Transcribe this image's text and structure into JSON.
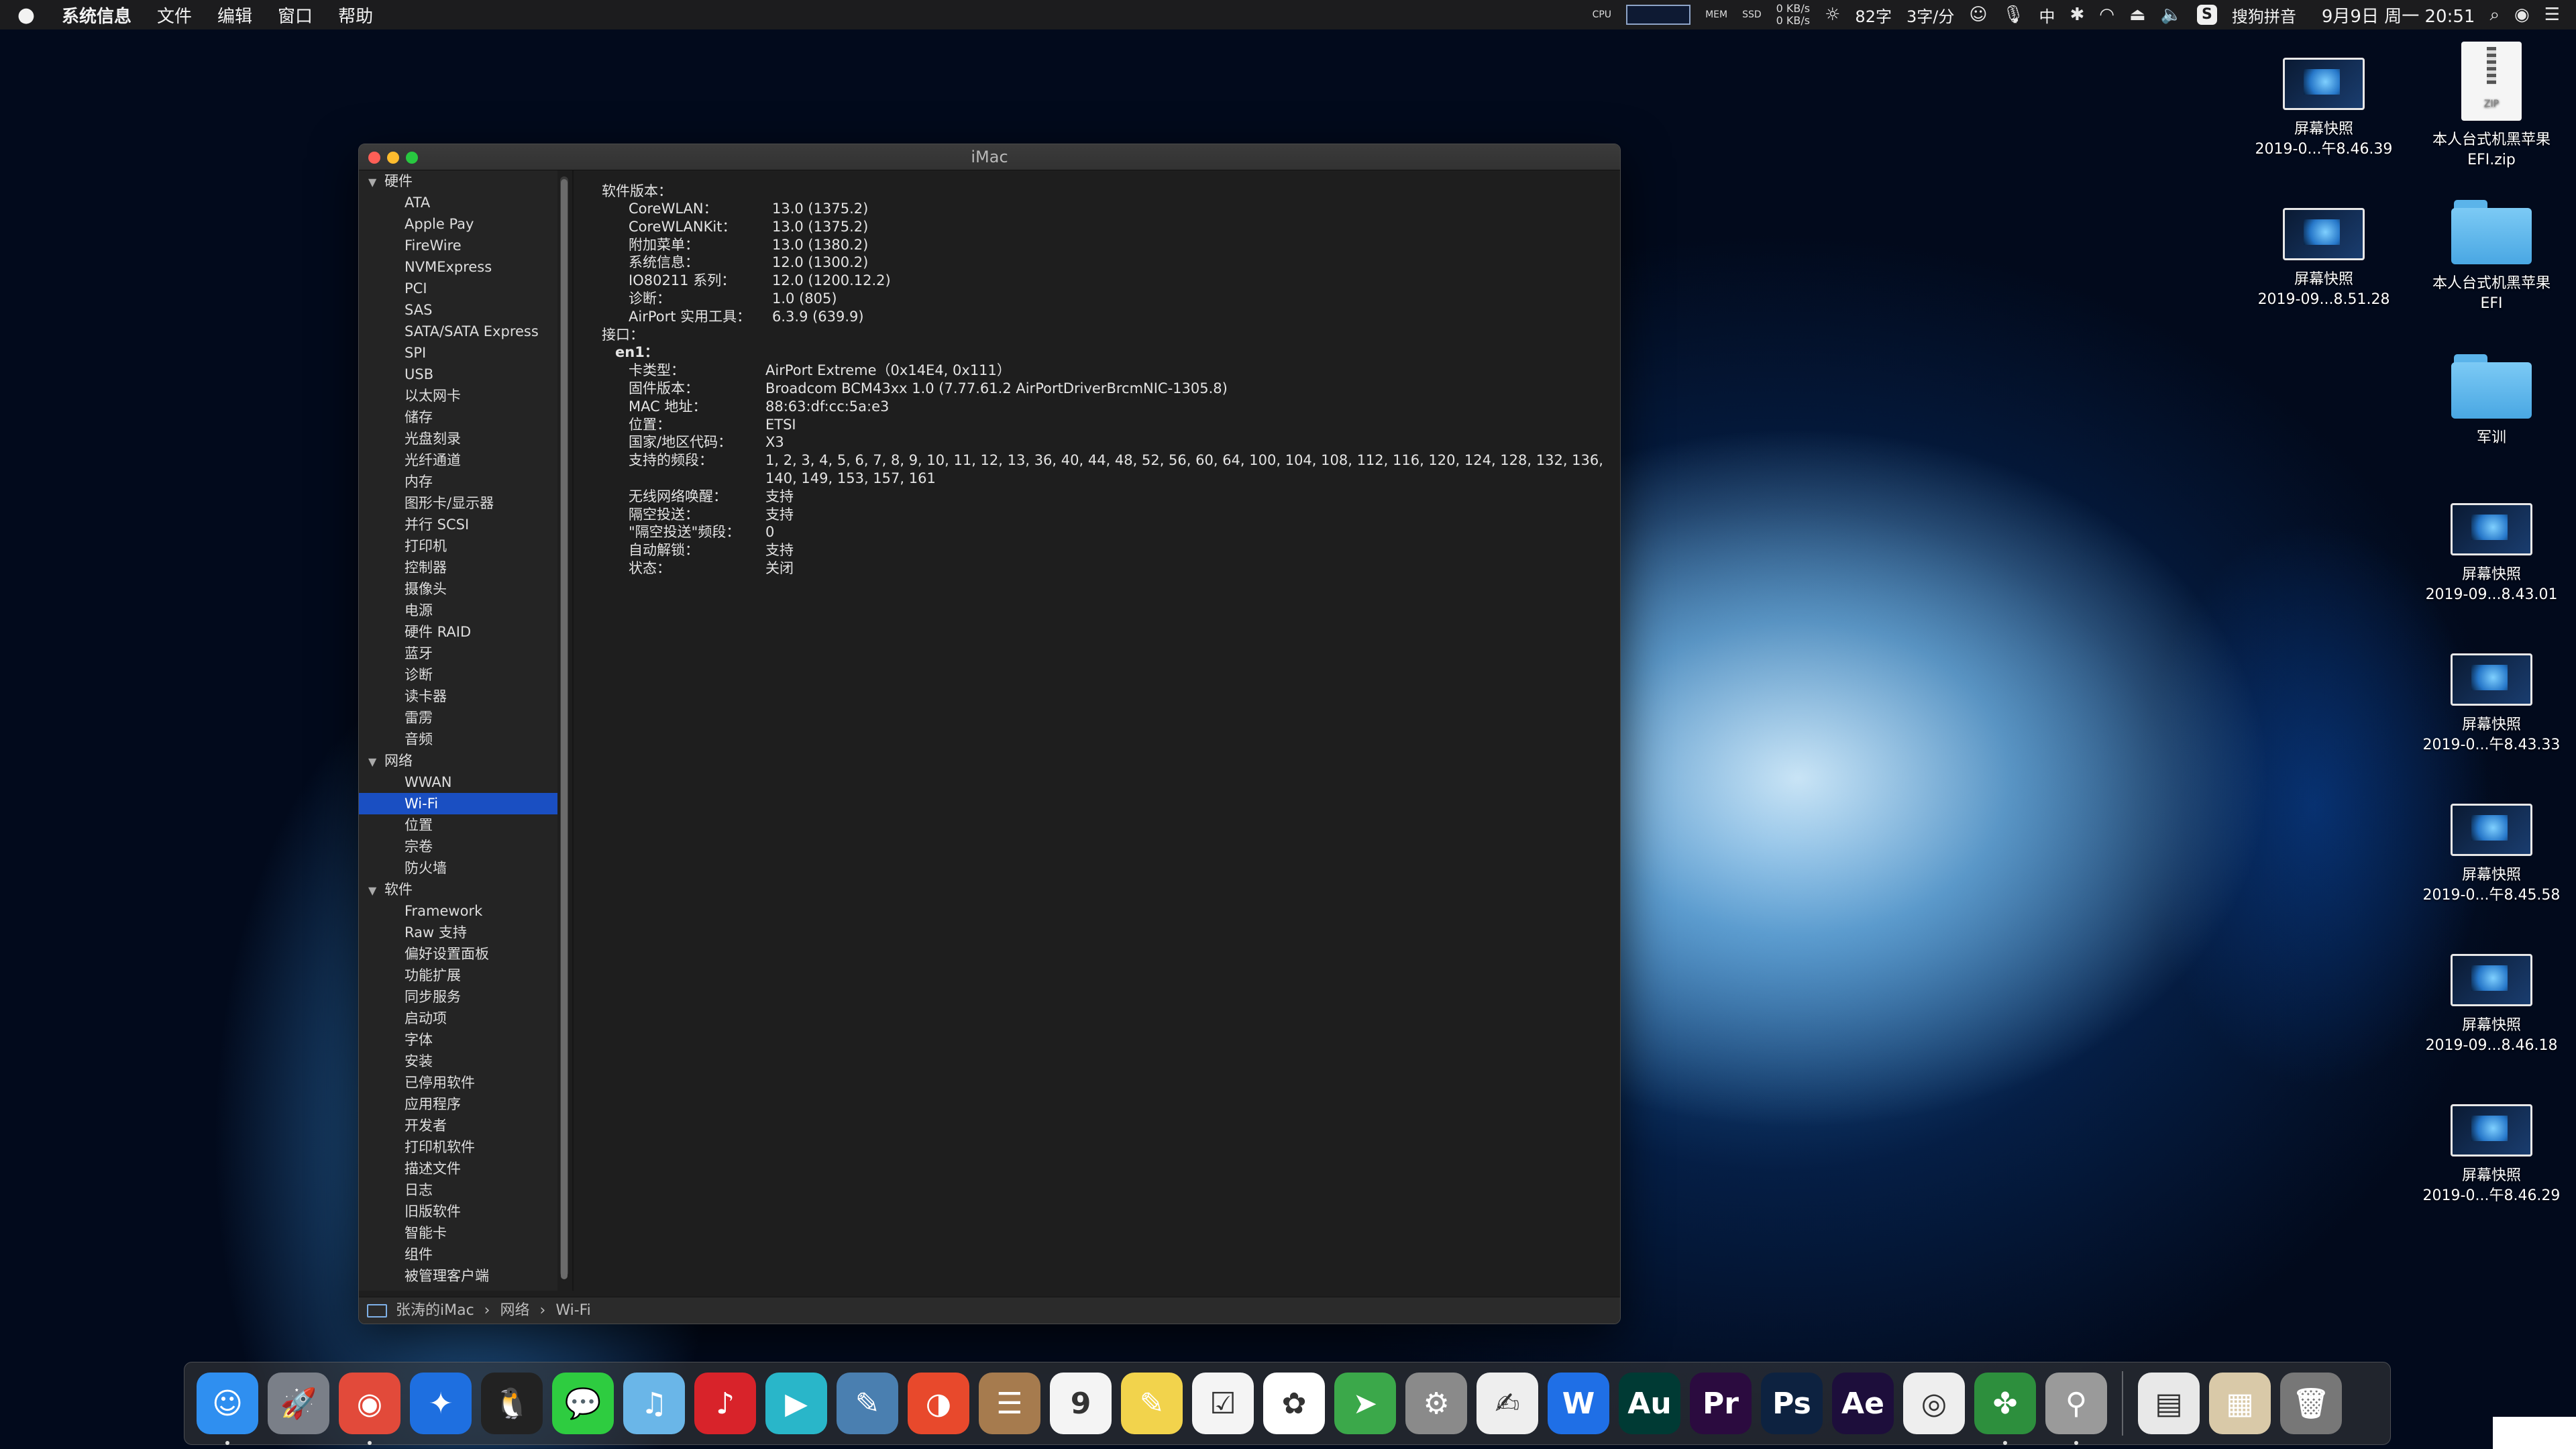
{
  "menubar": {
    "app_name": "系统信息",
    "menus": [
      "文件",
      "编辑",
      "窗口",
      "帮助"
    ],
    "net_up": "0 KB/s",
    "net_down": "0 KB/s",
    "brightness": "82字",
    "typing_speed": "3字/分",
    "input_method": "搜狗拼音",
    "clock": "9月9日 周一 20:51",
    "ime_char": "中"
  },
  "window": {
    "title": "iMac",
    "sidebar": {
      "sections": [
        {
          "label": "硬件",
          "items": [
            "ATA",
            "Apple Pay",
            "FireWire",
            "NVMExpress",
            "PCI",
            "SAS",
            "SATA/SATA Express",
            "SPI",
            "USB",
            "以太网卡",
            "储存",
            "光盘刻录",
            "光纤通道",
            "内存",
            "图形卡/显示器",
            "并行 SCSI",
            "打印机",
            "控制器",
            "摄像头",
            "电源",
            "硬件 RAID",
            "蓝牙",
            "诊断",
            "读卡器",
            "雷雳",
            "音频"
          ]
        },
        {
          "label": "网络",
          "items": [
            "WWAN",
            "Wi-Fi",
            "位置",
            "宗卷",
            "防火墙"
          ]
        },
        {
          "label": "软件",
          "items": [
            "Framework",
            "Raw 支持",
            "偏好设置面板",
            "功能扩展",
            "同步服务",
            "启动项",
            "字体",
            "安装",
            "已停用软件",
            "应用程序",
            "开发者",
            "打印机软件",
            "描述文件",
            "日志",
            "旧版软件",
            "智能卡",
            "组件",
            "被管理客户端"
          ]
        }
      ],
      "selected": "Wi-Fi"
    },
    "content": {
      "software_header": "软件版本：",
      "software": [
        {
          "k": "CoreWLAN：",
          "v": "13.0 (1375.2)"
        },
        {
          "k": "CoreWLANKit：",
          "v": "13.0 (1375.2)"
        },
        {
          "k": "附加菜单：",
          "v": "13.0 (1380.2)"
        },
        {
          "k": "系统信息：",
          "v": "12.0 (1300.2)"
        },
        {
          "k": "IO80211 系列：",
          "v": "12.0 (1200.12.2)"
        },
        {
          "k": "诊断：",
          "v": "1.0 (805)"
        },
        {
          "k": "AirPort 实用工具：",
          "v": "6.3.9 (639.9)"
        }
      ],
      "interfaces_header": "接口：",
      "iface_name": "en1：",
      "iface": [
        {
          "k": "卡类型：",
          "v": "AirPort Extreme（0x14E4, 0x111）"
        },
        {
          "k": "固件版本：",
          "v": "Broadcom BCM43xx 1.0 (7.77.61.2 AirPortDriverBrcmNIC-1305.8)"
        },
        {
          "k": "MAC 地址：",
          "v": "88:63:df:cc:5a:e3"
        },
        {
          "k": "位置：",
          "v": "ETSI"
        },
        {
          "k": "国家/地区代码：",
          "v": "X3"
        },
        {
          "k": "支持的频段：",
          "v": "1, 2, 3, 4, 5, 6, 7, 8, 9, 10, 11, 12, 13, 36, 40, 44, 48, 52, 56, 60, 64, 100, 104, 108, 112, 116, 120, 124, 128, 132, 136,"
        },
        {
          "k": "",
          "v": "140, 149, 153, 157, 161"
        },
        {
          "k": "无线网络唤醒：",
          "v": "支持"
        },
        {
          "k": "隔空投送：",
          "v": "支持"
        },
        {
          "k": "\"隔空投送\"频段：",
          "v": "0"
        },
        {
          "k": "自动解锁：",
          "v": "支持"
        },
        {
          "k": "状态：",
          "v": "关闭"
        }
      ]
    },
    "pathbar": [
      "张涛的iMac",
      "网络",
      "Wi-Fi"
    ],
    "pathbar_sep": "›"
  },
  "desktop": [
    {
      "type": "screenshot",
      "line1": "屏幕快照",
      "line2": "2019-0...午8.46.39"
    },
    {
      "type": "zip",
      "line1": "本人台式机黑苹果",
      "line2": "EFI.zip",
      "badge": "ZIP"
    },
    {
      "type": "screenshot",
      "line1": "屏幕快照",
      "line2": "2019-09...8.51.28"
    },
    {
      "type": "folder",
      "line1": "本人台式机黑苹果",
      "line2": "EFI"
    },
    {
      "type": "folder",
      "line1": "军训",
      "line2": ""
    },
    {
      "type": "screenshot",
      "line1": "屏幕快照",
      "line2": "2019-09...8.43.01"
    },
    {
      "type": "screenshot",
      "line1": "屏幕快照",
      "line2": "2019-0...午8.43.33"
    },
    {
      "type": "screenshot",
      "line1": "屏幕快照",
      "line2": "2019-0...午8.45.58"
    },
    {
      "type": "screenshot",
      "line1": "屏幕快照",
      "line2": "2019-09...8.46.18"
    },
    {
      "type": "screenshot",
      "line1": "屏幕快照",
      "line2": "2019-0...午8.46.29"
    }
  ],
  "dock": {
    "apps": [
      {
        "name": "finder-icon",
        "glyph": "☺",
        "color": "#2f8ff0",
        "running": true
      },
      {
        "name": "launchpad-icon",
        "glyph": "🚀",
        "color": "#7a7f88",
        "running": false
      },
      {
        "name": "chrome-icon",
        "glyph": "◉",
        "color": "#e24a3a",
        "running": true
      },
      {
        "name": "safari-icon",
        "glyph": "✦",
        "color": "#1e6fe0",
        "running": false
      },
      {
        "name": "qq-icon",
        "glyph": "🐧",
        "color": "#222222",
        "running": false
      },
      {
        "name": "wechat-icon",
        "glyph": "💬",
        "color": "#2ecc40",
        "running": false
      },
      {
        "name": "qq-music-icon",
        "glyph": "♫",
        "color": "#6ab6e8",
        "running": false
      },
      {
        "name": "netease-music-icon",
        "glyph": "♪",
        "color": "#d8232a",
        "running": false
      },
      {
        "name": "video-player-icon",
        "glyph": "▶",
        "color": "#29b6c9",
        "running": false
      },
      {
        "name": "preview-icon",
        "glyph": "✎",
        "color": "#4a7fb0",
        "running": false
      },
      {
        "name": "baidu-disk-icon",
        "glyph": "◑",
        "color": "#e8492c",
        "running": false
      },
      {
        "name": "contacts-icon",
        "glyph": "☰",
        "color": "#a67b4e",
        "running": false
      },
      {
        "name": "calendar-icon",
        "glyph": "9",
        "color": "#f4f4f4",
        "running": false
      },
      {
        "name": "notes-icon",
        "glyph": "✎",
        "color": "#f2d34c",
        "running": false
      },
      {
        "name": "reminders-icon",
        "glyph": "☑",
        "color": "#f4f4f4",
        "running": false
      },
      {
        "name": "photos-icon",
        "glyph": "✿",
        "color": "#ffffff",
        "running": false
      },
      {
        "name": "telegram-icon",
        "glyph": "➤",
        "color": "#3ba84a",
        "running": false
      },
      {
        "name": "system-preferences-icon",
        "glyph": "⚙",
        "color": "#8a8a8a",
        "running": false
      },
      {
        "name": "textedit-icon",
        "glyph": "✍",
        "color": "#eeeeee",
        "running": false
      },
      {
        "name": "wps-icon",
        "glyph": "W",
        "color": "#1f6fe6",
        "running": false
      },
      {
        "name": "audition-icon",
        "glyph": "Au",
        "color": "#003a34",
        "running": false
      },
      {
        "name": "premiere-icon",
        "glyph": "Pr",
        "color": "#2b0b3f",
        "running": false
      },
      {
        "name": "photoshop-icon",
        "glyph": "Ps",
        "color": "#0d2240",
        "running": false
      },
      {
        "name": "after-effects-icon",
        "glyph": "Ae",
        "color": "#1d0e3b",
        "running": false
      },
      {
        "name": "webcam-icon",
        "glyph": "◎",
        "color": "#eeeeee",
        "running": false
      },
      {
        "name": "clover-icon",
        "glyph": "✤",
        "color": "#2d8f3d",
        "running": true
      },
      {
        "name": "kext-utility-icon",
        "glyph": "⚲",
        "color": "#9a9a9a",
        "running": true
      }
    ],
    "stack": [
      {
        "name": "documents-stack-icon",
        "glyph": "▤",
        "color": "#e8e8e8"
      },
      {
        "name": "downloads-stack-icon",
        "glyph": "▦",
        "color": "#d9c9a8"
      },
      {
        "name": "trash-icon",
        "glyph": "🗑",
        "color": "#777777"
      }
    ]
  }
}
